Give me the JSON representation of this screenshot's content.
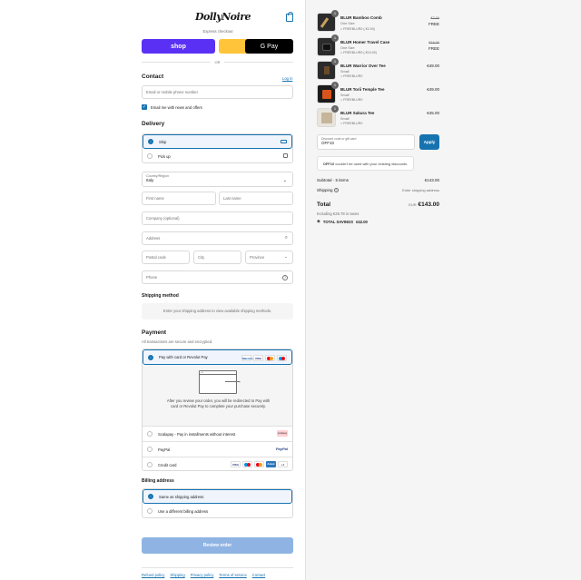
{
  "brand": {
    "logo_text": "DollyNoire"
  },
  "express": {
    "title": "Express checkout",
    "buttons": [
      "shop",
      "PayPal",
      "G Pay"
    ],
    "or_label": "OR"
  },
  "contact": {
    "heading": "Contact",
    "login_link": "Log in",
    "email_placeholder": "Email or mobile phone number",
    "newsletter_label": "Email me with news and offers",
    "newsletter_checked": true
  },
  "delivery": {
    "heading": "Delivery",
    "options": [
      {
        "label": "Ship",
        "selected": true,
        "icon": "truck-icon"
      },
      {
        "label": "Pick up",
        "selected": false,
        "icon": "store-icon"
      }
    ],
    "country_label": "Country/Region",
    "country_value": "Italy",
    "first_name_placeholder": "First name",
    "last_name_placeholder": "Last name",
    "company_placeholder": "Company (optional)",
    "address_placeholder": "Address",
    "postal_placeholder": "Postal code",
    "city_placeholder": "City",
    "province_placeholder": "Province",
    "phone_placeholder": "Phone"
  },
  "shipping_method": {
    "heading": "Shipping method",
    "info": "Enter your shipping address to view available shipping methods."
  },
  "payment": {
    "heading": "Payment",
    "subtitle": "All transactions are secure and encrypted.",
    "options": [
      {
        "label": "Pay with card or Revolut Pay",
        "selected": true
      },
      {
        "label": "Scalapay - Pay in installments without interest",
        "selected": false
      },
      {
        "label": "PayPal",
        "selected": false
      },
      {
        "label": "Credit card",
        "selected": false
      }
    ],
    "card_brands": [
      "Maestro",
      "VISA",
      "MC",
      "Amex"
    ],
    "redirect_text": "After you review your order, you will be redirected to Pay with card or Revolut Pay to complete your purchase securely.",
    "more_cards": "+1",
    "scalapay_badge": "scalapay",
    "paypal_badge": "PayPal"
  },
  "billing": {
    "heading": "Billing address",
    "options": [
      {
        "label": "Same as shipping address",
        "selected": true
      },
      {
        "label": "Use a different billing address",
        "selected": false
      }
    ]
  },
  "review_button": "Review order",
  "footer_links": [
    "Refund policy",
    "Shipping",
    "Privacy policy",
    "Terms of service",
    "Contact"
  ],
  "cart": {
    "items": [
      {
        "name": "BLUR Bamboo Comb",
        "variant": "One Size",
        "discount": "FREEBLUR0 (-€2.00)",
        "orig_price": "€2.00",
        "price": "FREE",
        "qty": "1"
      },
      {
        "name": "BLUR Homer Travel Case",
        "variant": "One Size",
        "discount": "FREEBLUR0 (-€15.00)",
        "orig_price": "€15.00",
        "price": "FREE",
        "qty": "1"
      },
      {
        "name": "BLUR Warrior Over Tee",
        "variant": "Small",
        "discount": "FREEBLUR0",
        "orig_price": "",
        "price": "€49.00",
        "qty": "1"
      },
      {
        "name": "BLUR Torii Temple Tee",
        "variant": "Small",
        "discount": "FREEBLUR0",
        "orig_price": "",
        "price": "€49.00",
        "qty": "1"
      },
      {
        "name": "BLUR Sakura Tee",
        "variant": "Small",
        "discount": "FREEBLUR0",
        "orig_price": "",
        "price": "€45.00",
        "qty": "1"
      }
    ],
    "discount_label": "Discount code or gift card",
    "discount_value": "OFF10",
    "apply_label": "Apply",
    "notice_code": "OFF10",
    "notice_text": "couldn't be used with your existing discounts.",
    "subtotal_label": "Subtotal · 5 items",
    "subtotal_value": "€143.00",
    "shipping_label": "Shipping",
    "shipping_value": "Enter shipping address",
    "total_label": "Total",
    "currency": "EUR",
    "total_value": "€143.00",
    "taxes_text": "Including €25.78 in taxes",
    "savings_label": "TOTAL SAVINGS",
    "savings_value": "€42.00"
  },
  "colors": {
    "accent": "#1773b0",
    "shop_pay": "#5a31f4",
    "paypal": "#ffc439",
    "review_disabled": "#8fb4e3"
  }
}
